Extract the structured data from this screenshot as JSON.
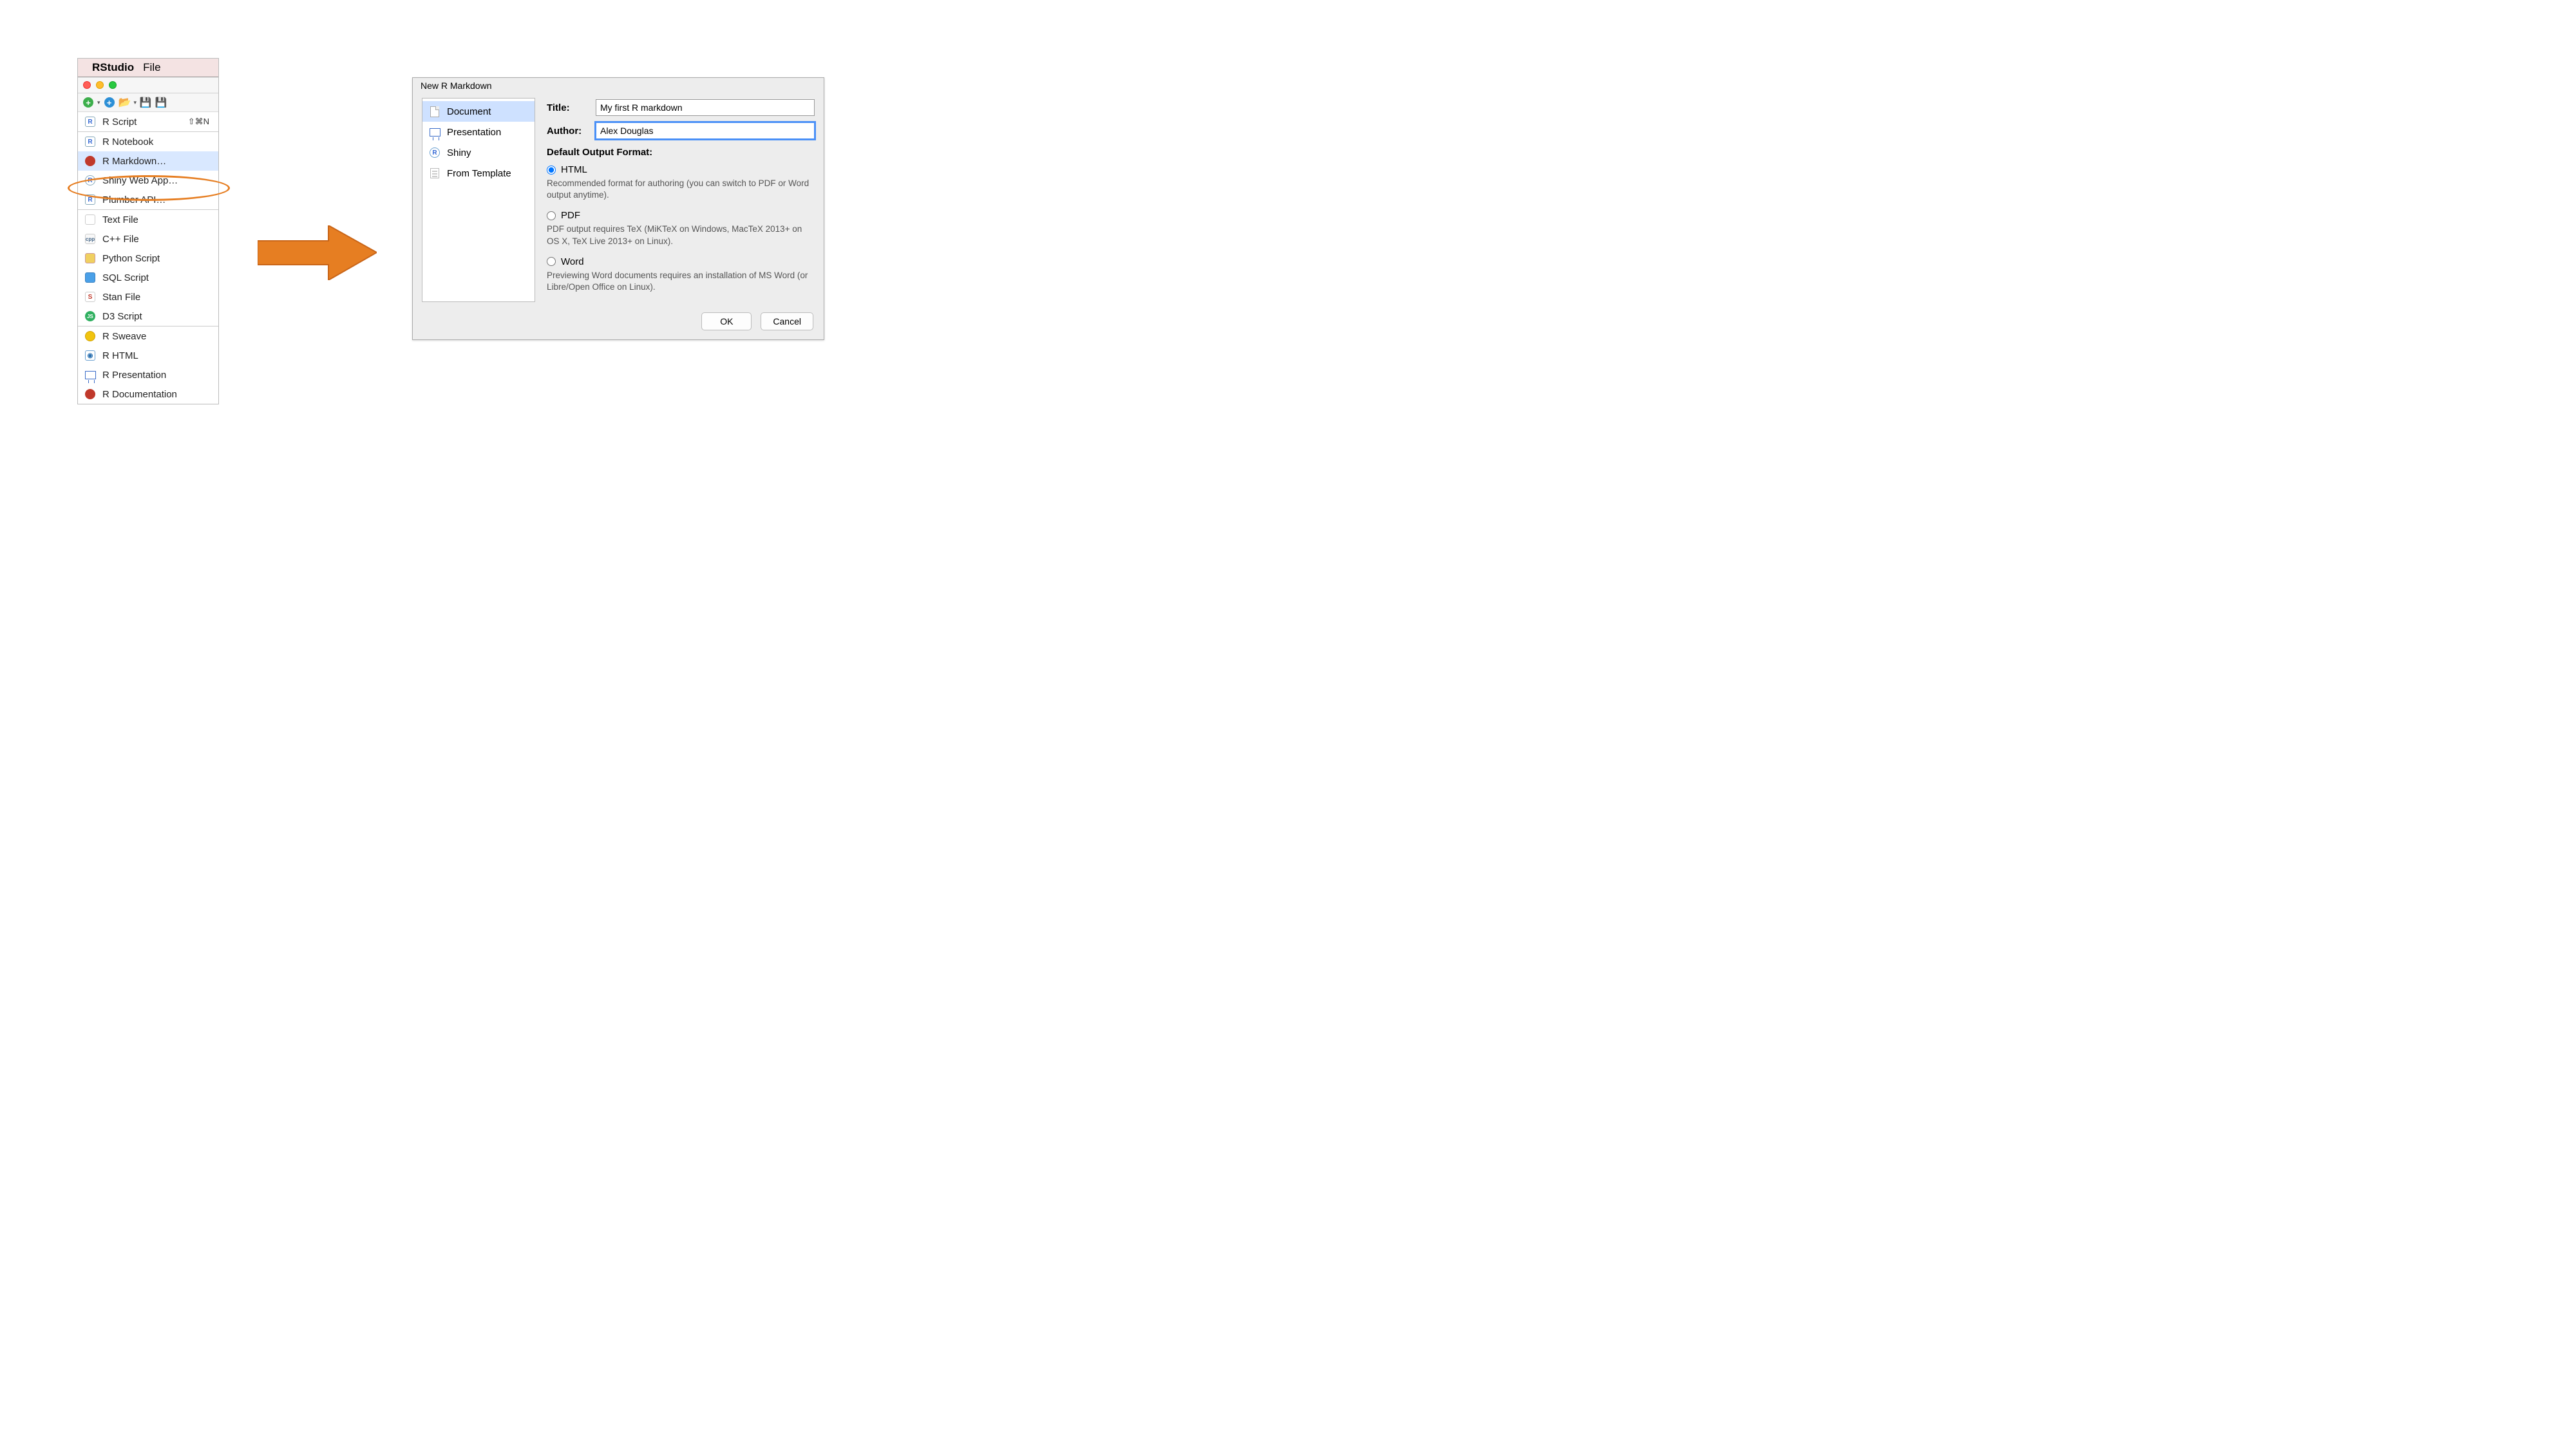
{
  "menubar": {
    "app": "RStudio",
    "file": "File"
  },
  "menu": {
    "items": [
      {
        "label": "R Script",
        "shortcut": "⇧⌘N",
        "icon": "r"
      },
      {
        "label": "R Notebook",
        "icon": "notebook"
      },
      {
        "label": "R Markdown…",
        "icon": "rmd",
        "highlighted": true
      },
      {
        "label": "Shiny Web App…",
        "icon": "shiny"
      },
      {
        "label": "Plumber API…",
        "icon": "plumber"
      }
    ],
    "group2": [
      {
        "label": "Text File",
        "icon": "text"
      },
      {
        "label": "C++ File",
        "icon": "cpp"
      },
      {
        "label": "Python Script",
        "icon": "py"
      },
      {
        "label": "SQL Script",
        "icon": "sql"
      },
      {
        "label": "Stan File",
        "icon": "stan"
      },
      {
        "label": "D3 Script",
        "icon": "d3"
      }
    ],
    "group3": [
      {
        "label": "R Sweave",
        "icon": "sweave"
      },
      {
        "label": "R HTML",
        "icon": "html"
      },
      {
        "label": "R Presentation",
        "icon": "pres"
      },
      {
        "label": "R Documentation",
        "icon": "doc"
      }
    ]
  },
  "dialog": {
    "title": "New R Markdown",
    "left": {
      "items": [
        {
          "label": "Document",
          "selected": true
        },
        {
          "label": "Presentation"
        },
        {
          "label": "Shiny"
        },
        {
          "label": "From Template"
        }
      ]
    },
    "form": {
      "title_label": "Title:",
      "title_value": "My first R markdown",
      "author_label": "Author:",
      "author_value": "Alex Douglas",
      "section": "Default Output Format:",
      "radios": [
        {
          "label": "HTML",
          "checked": true,
          "help": "Recommended format for authoring (you can switch to PDF or Word output anytime)."
        },
        {
          "label": "PDF",
          "help": "PDF output requires TeX (MiKTeX on Windows, MacTeX 2013+ on OS X, TeX Live 2013+ on Linux)."
        },
        {
          "label": "Word",
          "help": "Previewing Word documents requires an installation of MS Word (or Libre/Open Office on Linux)."
        }
      ],
      "ok": "OK",
      "cancel": "Cancel"
    }
  }
}
